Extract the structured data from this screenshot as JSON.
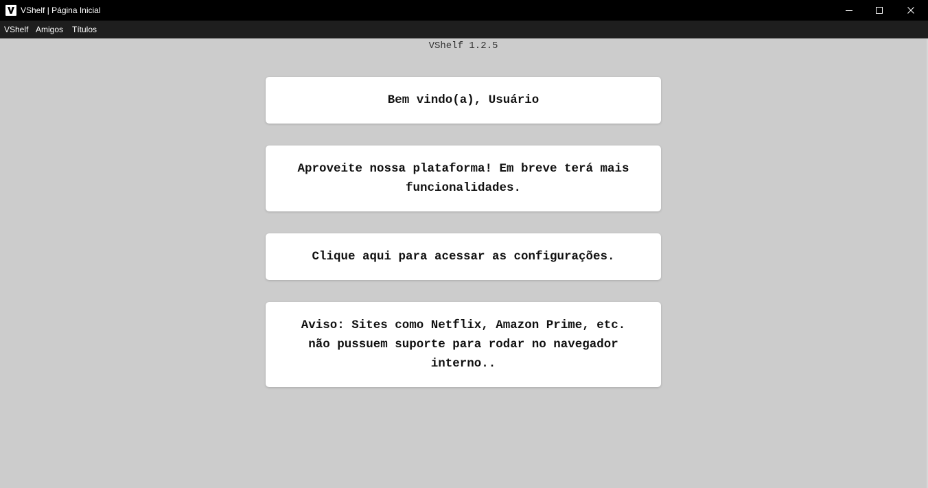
{
  "window": {
    "title": "VShelf | Página Inicial",
    "controls": [
      "minimize-icon",
      "maximize-icon",
      "close-icon"
    ]
  },
  "menu": {
    "items": [
      {
        "label": "VShelf"
      },
      {
        "label": "Amigos"
      },
      {
        "label": "Títulos"
      }
    ]
  },
  "main": {
    "version": "VShelf 1.2.5",
    "cards": [
      {
        "text": "Bem vindo(a), Usuário"
      },
      {
        "text": "Aproveite nossa plataforma! Em breve terá mais funcionalidades."
      },
      {
        "text": "Clique aqui para acessar as configurações."
      },
      {
        "text": "Aviso: Sites como Netflix, Amazon Prime, etc. não pussuem suporte para rodar no navegador interno.."
      }
    ]
  },
  "colors": {
    "titlebar": "#000000",
    "menubar": "#1e1e1e",
    "background": "#cccccc",
    "card": "#ffffff"
  }
}
